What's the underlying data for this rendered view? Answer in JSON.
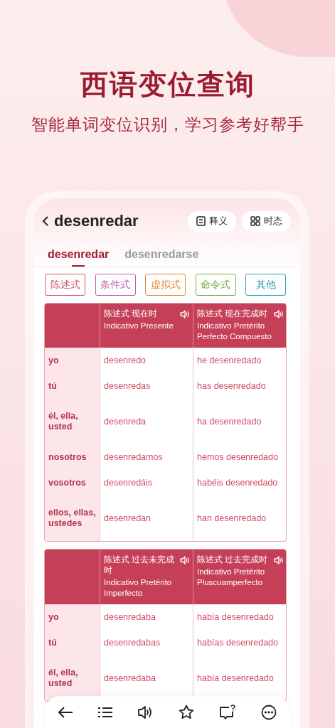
{
  "title": "西语变位查询",
  "subtitle": "智能单词变位识别，学习参考好帮手",
  "word": "desenredar",
  "header_buttons": [
    {
      "kind": "definition",
      "label": "释义"
    },
    {
      "kind": "tenses",
      "label": "时态"
    }
  ],
  "tabs": [
    {
      "label": "desenredar",
      "selected": true
    },
    {
      "label": "desenredarse",
      "selected": false
    }
  ],
  "moods": [
    {
      "label": "陈述式",
      "color": "#d0566e"
    },
    {
      "label": "条件式",
      "color": "#c05bb0"
    },
    {
      "label": "虚拟式",
      "color": "#e8892e"
    },
    {
      "label": "命令式",
      "color": "#6fae3c"
    },
    {
      "label": "其他",
      "color": "#2aa0b5"
    }
  ],
  "tables": [
    {
      "columns": [
        {
          "zh": "陈述式 现在时",
          "es": "Indicativo Presente"
        },
        {
          "zh": "陈述式 现在完成时",
          "es": "Indicativo Pretérito Perfecto Compuesto"
        }
      ],
      "rows": [
        {
          "person": "yo",
          "forms": [
            "desenredo",
            "he desenredado"
          ]
        },
        {
          "person": "tú",
          "forms": [
            "desenredas",
            "has desenredado"
          ]
        },
        {
          "person": "él, ella, usted",
          "forms": [
            "desenreda",
            "ha desenredado"
          ]
        },
        {
          "person": "nosotros",
          "forms": [
            "desenredamos",
            "hemos desenredado"
          ]
        },
        {
          "person": "vosotros",
          "forms": [
            "desenredáis",
            "habéis desenredado"
          ]
        },
        {
          "person": "ellos, ellas, ustedes",
          "forms": [
            "desenredan",
            "han desenredado"
          ]
        }
      ]
    },
    {
      "columns": [
        {
          "zh": "陈述式 过去未完成时",
          "es": "Indicativo Pretérito Imperfecto"
        },
        {
          "zh": "陈述式 过去完成时",
          "es": "Indicativo Pretérito Pluscuamperfecto"
        }
      ],
      "rows": [
        {
          "person": "yo",
          "forms": [
            "desenredaba",
            "había desenredado"
          ]
        },
        {
          "person": "tú",
          "forms": [
            "desenredabas",
            "habías desenredado"
          ]
        },
        {
          "person": "él, ella, usted",
          "forms": [
            "desenredaba",
            "había desenredado"
          ]
        }
      ]
    }
  ]
}
